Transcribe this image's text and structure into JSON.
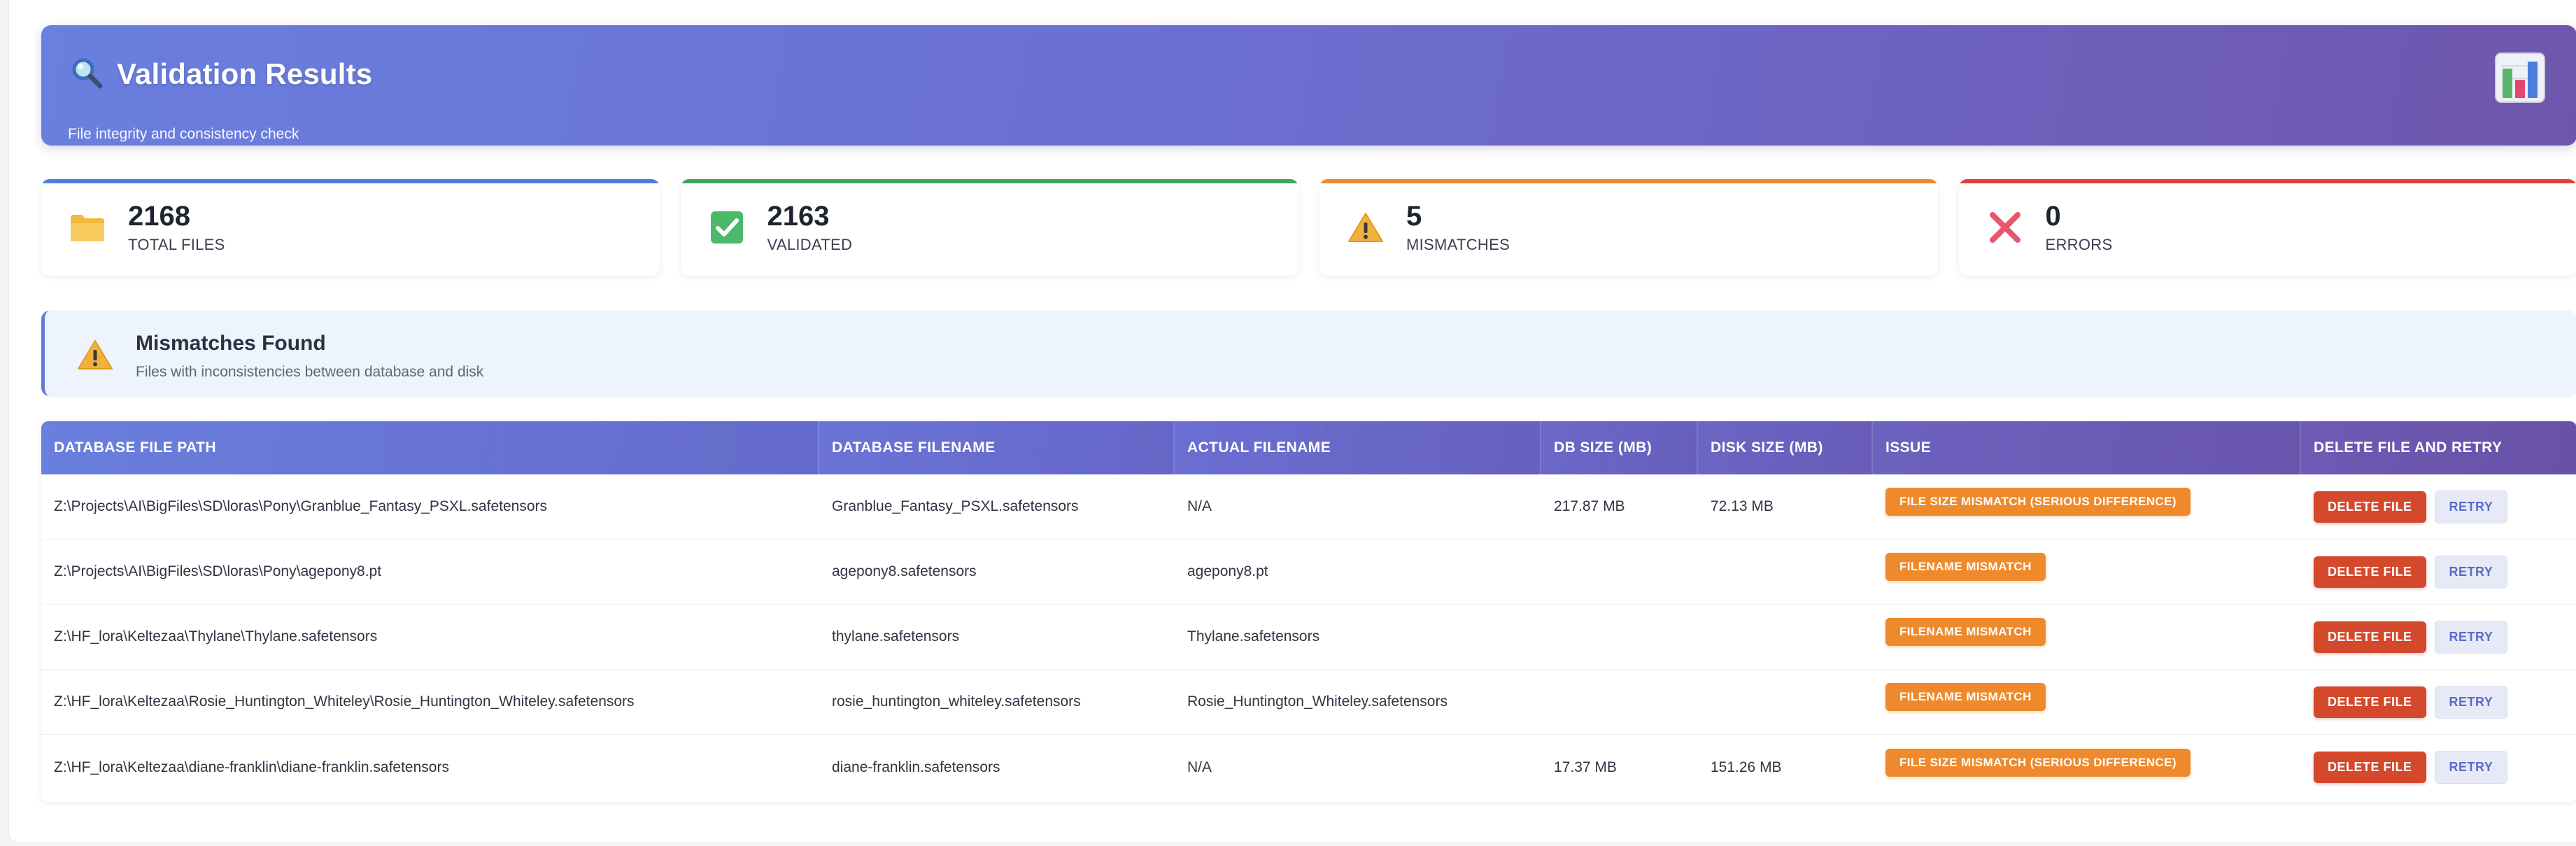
{
  "header": {
    "title": "Validation Results",
    "subtitle": "File integrity and consistency check",
    "title_icon": "magnifier-icon",
    "corner_icon": "bar-chart-icon"
  },
  "stats": [
    {
      "value": "2168",
      "label": "TOTAL FILES",
      "icon": "folder-icon",
      "accent": "#4a7fe0"
    },
    {
      "value": "2163",
      "label": "VALIDATED",
      "icon": "checkbox-icon",
      "accent": "#3fa55a"
    },
    {
      "value": "5",
      "label": "MISMATCHES",
      "icon": "warning-icon",
      "accent": "#ee8a2c"
    },
    {
      "value": "0",
      "label": "ERRORS",
      "icon": "cross-icon",
      "accent": "#e0403a"
    }
  ],
  "banner": {
    "title": "Mismatches Found",
    "subtitle": "Files with inconsistencies between database and disk"
  },
  "table": {
    "headers": [
      "DATABASE FILE PATH",
      "DATABASE FILENAME",
      "ACTUAL FILENAME",
      "DB SIZE (MB)",
      "DISK SIZE (MB)",
      "ISSUE",
      "DELETE FILE AND RETRY"
    ],
    "delete_label": "DELETE FILE",
    "retry_label": "RETRY",
    "rows": [
      {
        "path": "Z:\\Projects\\AI\\BigFiles\\SD\\loras\\Pony\\Granblue_Fantasy_PSXL.safetensors",
        "db_filename": "Granblue_Fantasy_PSXL.safetensors",
        "actual_filename": "N/A",
        "db_size": "217.87 MB",
        "disk_size": "72.13 MB",
        "issue": "FILE SIZE MISMATCH (SERIOUS DIFFERENCE)"
      },
      {
        "path": "Z:\\Projects\\AI\\BigFiles\\SD\\loras\\Pony\\agepony8.pt",
        "db_filename": "agepony8.safetensors",
        "actual_filename": "agepony8.pt",
        "db_size": "",
        "disk_size": "",
        "issue": "FILENAME MISMATCH"
      },
      {
        "path": "Z:\\HF_lora\\Keltezaa\\Thylane\\Thylane.safetensors",
        "db_filename": "thylane.safetensors",
        "actual_filename": "Thylane.safetensors",
        "db_size": "",
        "disk_size": "",
        "issue": "FILENAME MISMATCH"
      },
      {
        "path": "Z:\\HF_lora\\Keltezaa\\Rosie_Huntington_Whiteley\\Rosie_Huntington_Whiteley.safetensors",
        "db_filename": "rosie_huntington_whiteley.safetensors",
        "actual_filename": "Rosie_Huntington_Whiteley.safetensors",
        "db_size": "",
        "disk_size": "",
        "issue": "FILENAME MISMATCH"
      },
      {
        "path": "Z:\\HF_lora\\Keltezaa\\diane-franklin\\diane-franklin.safetensors",
        "db_filename": "diane-franklin.safetensors",
        "actual_filename": "N/A",
        "db_size": "17.37 MB",
        "disk_size": "151.26 MB",
        "issue": "FILE SIZE MISMATCH (SERIOUS DIFFERENCE)"
      }
    ]
  }
}
